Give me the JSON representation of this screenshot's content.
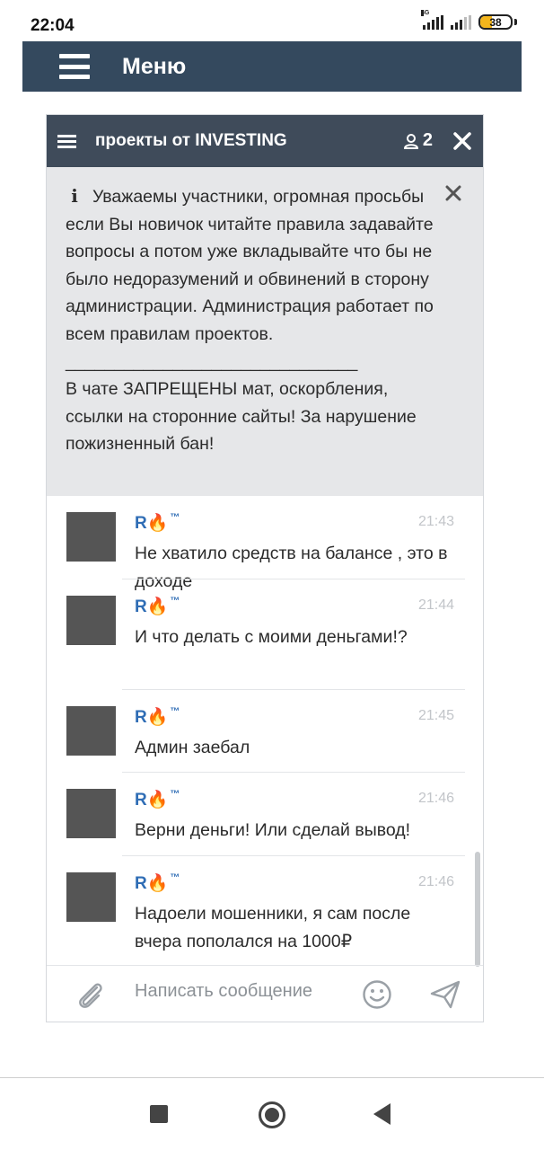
{
  "status_bar": {
    "time": "22:04",
    "network": "4G",
    "battery_level": "38",
    "battery_percent": 38
  },
  "menu_bar": {
    "title": "Меню"
  },
  "chat": {
    "title": "проекты от INVESTING",
    "user_count": "2",
    "notice": {
      "icon": "info-icon",
      "text": "Уважаемы участники, огромная просьбы если Вы новичок читайте правила задавайте вопросы а потом уже вкладывайте что бы не было недоразумений и обвинений в сторону администрации. Администрация работает по всем правилам проектов.\n______________________________\nВ чате ЗАПРЕЩЕНЫ мат, оскорбления, ссылки на сторонние сайты! За нарушение пожизненный бан!"
    },
    "messages": [
      {
        "author": "R🔥",
        "badge": "™",
        "time": "21:43",
        "text": "Не хватило средств на балансе , это в доходе"
      },
      {
        "author": "R🔥",
        "badge": "™",
        "time": "21:44",
        "text": "И что делать с моими деньгами!?"
      },
      {
        "author": "R🔥",
        "badge": "™",
        "time": "21:45",
        "text": "Админ заебал"
      },
      {
        "author": "R🔥",
        "badge": "™",
        "time": "21:46",
        "text": "Верни деньги! Или сделай вывод!"
      },
      {
        "author": "R🔥",
        "badge": "™",
        "time": "21:46",
        "text": "Надоели мошенники, я сам после вчера пополался на 1000₽"
      }
    ],
    "composer": {
      "placeholder": "Написать сообщение"
    }
  },
  "colors": {
    "menu_bar_bg": "#34495e",
    "chat_header_bg": "#3f4b5a",
    "notice_bg": "#e6e7e9",
    "author_color": "#2f6db5",
    "battery_fill": "#f3b51c"
  }
}
